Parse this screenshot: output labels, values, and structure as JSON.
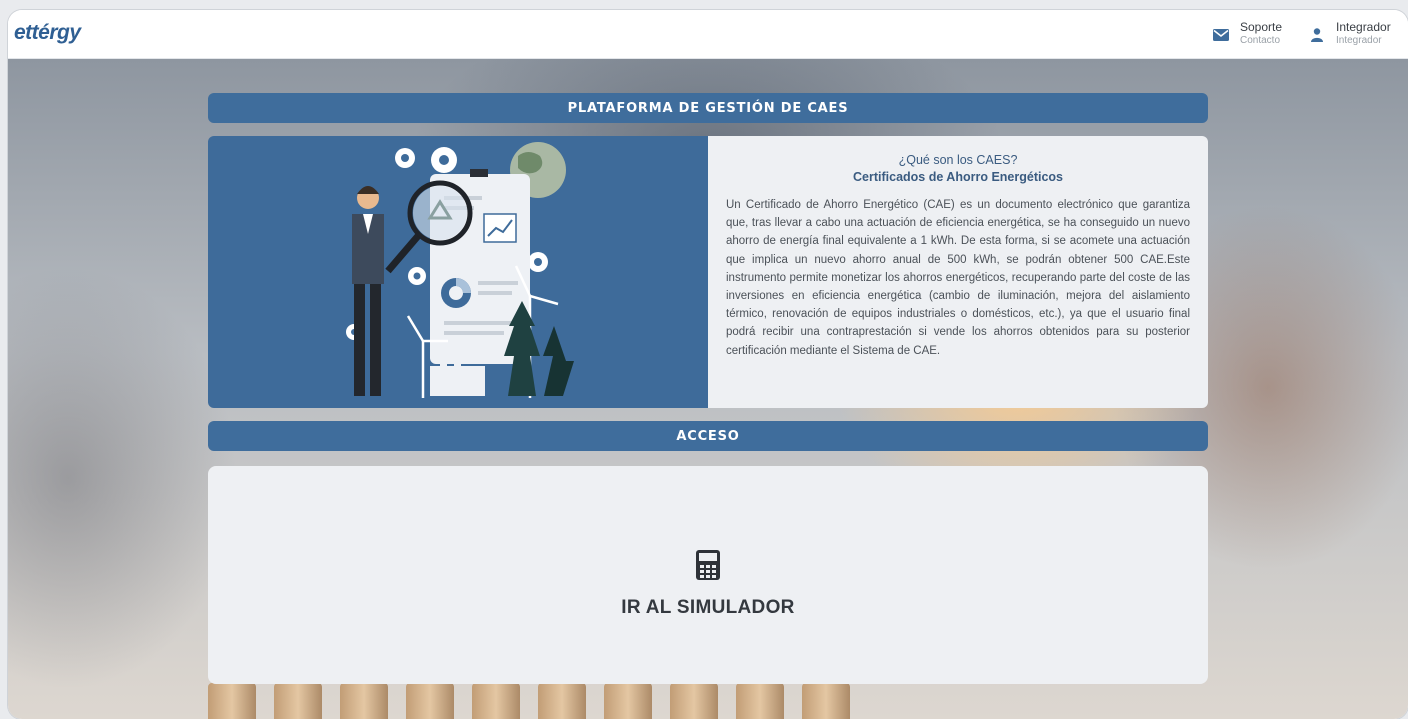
{
  "header": {
    "logo": "ettérgy",
    "support": {
      "label": "Soporte",
      "sublabel": "Contacto",
      "icon": "envelope-icon"
    },
    "integrator": {
      "label": "Integrador",
      "sublabel": "Integrador",
      "icon": "user-icon"
    }
  },
  "sections": {
    "platform_title": "PLATAFORMA DE GESTIÓN DE CAES",
    "access_title": "ACCESO"
  },
  "info": {
    "question": "¿Qué son los CAES?",
    "subtitle": "Certificados de Ahorro Energéticos",
    "body": "Un Certificado de Ahorro Energético (CAE) es un documento electrónico que garantiza que, tras llevar a cabo una actuación de eficiencia energética, se ha conseguido un nuevo ahorro de energía final equivalente a 1 kWh. De esta forma, si se acomete una actuación que implica un nuevo ahorro anual de 500 kWh, se podrán obtener 500 CAE.Este instrumento permite monetizar los ahorros energéticos, recuperando parte del coste de las inversiones en eficiencia energética (cambio de iluminación, mejora del aislamiento térmico, renovación de equipos industriales o domésticos, etc.), ya que el usuario final podrá recibir una contraprestación si vende los ahorros obtenidos para su posterior certificación mediante el Sistema de CAE."
  },
  "access": {
    "simulator_label": "IR AL SIMULADOR",
    "icon": "calculator-icon"
  },
  "colors": {
    "primary": "#3f6d9c",
    "illustration_bg": "#3e6b9a",
    "card_bg": "#eef0f3"
  }
}
